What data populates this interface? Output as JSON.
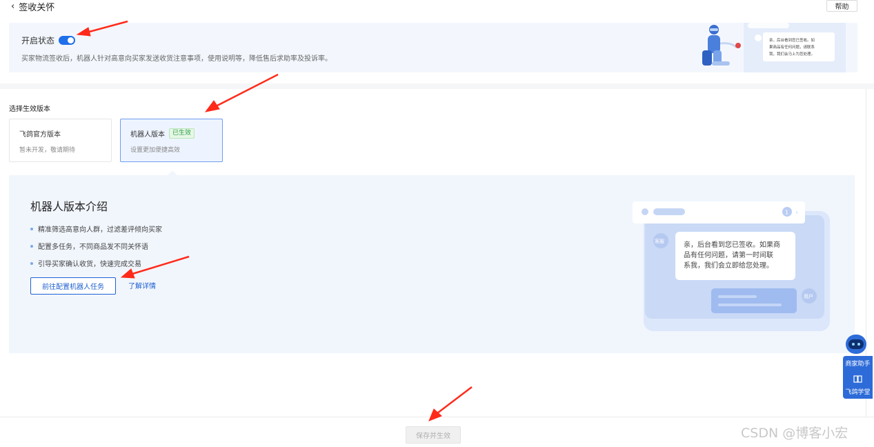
{
  "header": {
    "back_label": "签收关怀",
    "help_label": "帮助"
  },
  "status": {
    "label": "开启状态",
    "enabled": true,
    "description": "买家物流签收后，机器人针对高意向买家发送收货注意事项，使用说明等，降低售后求助率及投诉率。",
    "illustration_text": "亲，后台看到您已签收，如果商品有任何问题，请联系我，我们会马上为您处理。"
  },
  "version_section": {
    "title": "选择生效版本",
    "cards": [
      {
        "title": "飞鸽官方版本",
        "subtitle": "暂未开发，敬请期待",
        "badge": ""
      },
      {
        "title": "机器人版本",
        "subtitle": "设置更加便捷高效",
        "badge": "已生效"
      }
    ]
  },
  "intro": {
    "title": "机器人版本介绍",
    "bullets": [
      "精准筛选高意向人群，过滤差评倾向买家",
      "配置多任务，不同商品发不同关怀语",
      "引导买家确认收货，快速完成交易"
    ],
    "config_button": "前往配置机器人任务",
    "more_link": "了解详情",
    "chat": {
      "agent_tag": "客服",
      "message": "亲，后台看到您已签收。如果商品有任何问题，请第一时间联系我，我们会立即给您处理。",
      "user_tag": "用户",
      "step": "1"
    }
  },
  "floating": {
    "assistant_label": "商家助手",
    "academy_label": "飞鸽学堂"
  },
  "footer": {
    "save_label": "保存并生效"
  },
  "watermark": "CSDN @博客小宏",
  "colors": {
    "accent": "#1f6feb",
    "panel_bg": "#f1f6fd",
    "arrow": "#ff2a1a",
    "badge_green": "#2f9e44"
  }
}
